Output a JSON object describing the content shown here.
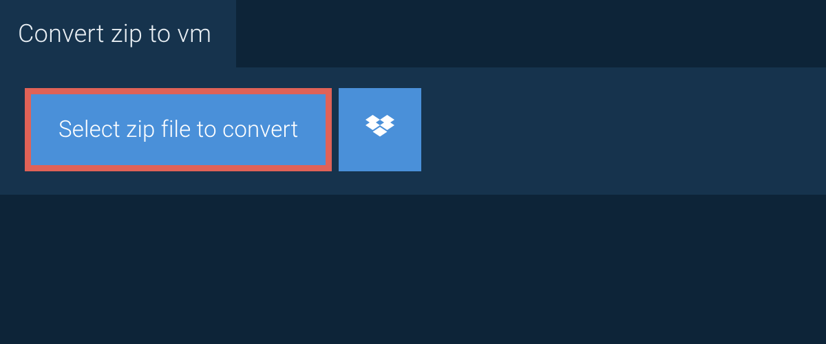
{
  "tab": {
    "title": "Convert zip to vm"
  },
  "actions": {
    "select_label": "Select zip file to convert"
  },
  "colors": {
    "bg_dark": "#0d2438",
    "bg_panel": "#16334d",
    "button_blue": "#4a90d9",
    "highlight_border": "#e06257",
    "text_light": "#e8eef3",
    "text_white": "#ffffff"
  }
}
